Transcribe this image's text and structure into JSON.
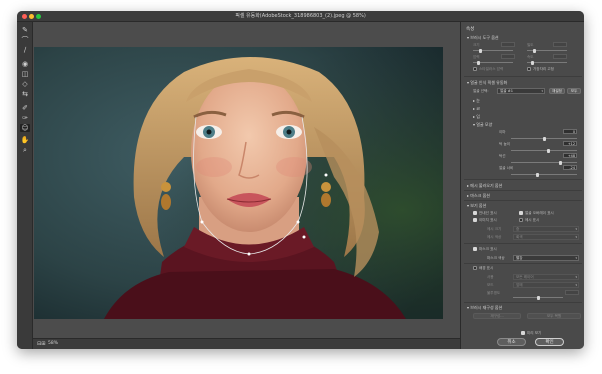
{
  "window": {
    "title": "픽셀 유동화(AdobeStock_318986803_(2).jpeg @ 58%)"
  },
  "toolbar": {
    "tools": [
      "forward-warp",
      "reconstruct",
      "smooth",
      "twirl",
      "pucker",
      "bloat",
      "push-left",
      "freeze-mask",
      "thaw-mask",
      "face-tool",
      "hand",
      "zoom"
    ]
  },
  "status": {
    "zoom": "58%"
  },
  "panel": {
    "title": "속성",
    "brush": {
      "header": "브러시 도구 옵션",
      "size_label": "크기",
      "size_value": "",
      "density_label": "밀도",
      "density_value": "",
      "pressure_label": "압력",
      "pressure_value": "",
      "rate_label": "속도",
      "rate_value": "",
      "stylus_label": "스타일러스 압력",
      "pin_label": "가장자리 고정"
    },
    "face": {
      "header": "얼굴 인식 픽셀 유동화",
      "select_label": "얼굴 선택:",
      "select_value": "얼굴 #1",
      "reset_label": "재설정",
      "all_label": "모두",
      "eyes_label": "눈",
      "nose_label": "코",
      "mouth_label": "입",
      "shape_label": "얼굴 모양",
      "forehead_label": "이마",
      "forehead_value": "0",
      "jaw_label": "턱 높이",
      "jaw_value": "+12",
      "chin_label": "턱선",
      "chin_value": "+48",
      "width_label": "얼굴 너비",
      "width_value": "-24"
    },
    "load_mesh": "메시 불러오기 옵션",
    "mask": "마스크 옵션",
    "view": {
      "header": "보기 옵션",
      "guides": "안내선 표시",
      "face_overlay": "얼굴 오버레이 표시",
      "image": "이미지 표시",
      "mesh": "메시 표시",
      "mesh_size_label": "메시 크기",
      "mesh_size_value": "중",
      "mesh_color_label": "메시 색상",
      "mesh_color_value": "회색"
    },
    "mask_show": {
      "label": "마스크 표시",
      "color_label": "마스크 색상",
      "color_value": "빨강"
    },
    "backdrop": {
      "label": "배경 표시",
      "use_label": "사용",
      "use_value": "모든 레이어",
      "mode_label": "모드",
      "mode_value": "앞에",
      "opacity_label": "불투명도",
      "opacity_value": ""
    },
    "brush_recon": {
      "header": "브러시 재구성 옵션",
      "reconstruct_label": "재구성...",
      "restore_label": "모두 복원"
    },
    "preview_label": "미리 보기",
    "cancel_label": "취소",
    "ok_label": "확인"
  },
  "colors": {
    "panel": "#4a4a4a",
    "window": "#535353",
    "sweater": "#5a1420",
    "background": "#2f4a4f"
  }
}
